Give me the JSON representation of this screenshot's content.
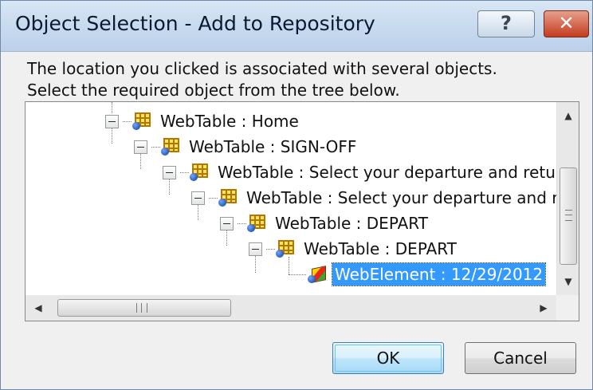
{
  "dialog": {
    "title": "Object Selection - Add to Repository",
    "help_glyph": "?",
    "close_glyph": "✕"
  },
  "message": {
    "line1": "The location you clicked is associated with several objects.",
    "line2": "Select the required object from the tree below."
  },
  "tree": {
    "nodes": [
      {
        "label": "WebTable : Home",
        "icon": "webtable-icon",
        "expanded": true
      },
      {
        "label": "WebTable : SIGN-OFF",
        "icon": "webtable-icon",
        "expanded": true
      },
      {
        "label": "WebTable : Select your departure and returr",
        "icon": "webtable-icon",
        "expanded": true
      },
      {
        "label": "WebTable : Select your departure and re",
        "icon": "webtable-icon",
        "expanded": true
      },
      {
        "label": "WebTable : DEPART",
        "icon": "webtable-icon",
        "expanded": true
      },
      {
        "label": "WebTable : DEPART",
        "icon": "webtable-icon",
        "expanded": true
      },
      {
        "label": "WebElement : 12/29/2012",
        "icon": "webelement-icon",
        "selected": true
      }
    ]
  },
  "scrollbars": {
    "up_glyph": "▲",
    "down_glyph": "▼",
    "left_glyph": "◀",
    "right_glyph": "▶"
  },
  "buttons": {
    "ok_label": "OK",
    "cancel_label": "Cancel"
  },
  "colors": {
    "selection": "#3399ff",
    "close_button": "#c53a1f"
  }
}
